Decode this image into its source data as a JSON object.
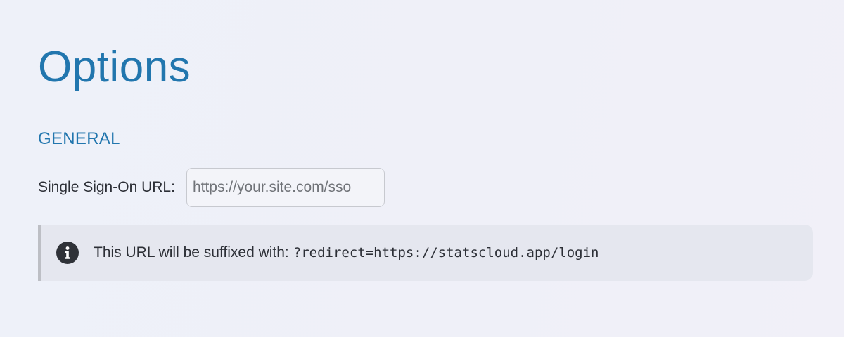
{
  "page": {
    "title": "Options"
  },
  "general_section": {
    "heading": "GENERAL",
    "sso_url": {
      "label": "Single Sign-On URL:",
      "value": "",
      "placeholder": "https://your.site.com/sso"
    }
  },
  "notice": {
    "icon": "info-icon",
    "text": "This URL will be suffixed with:",
    "code": "?redirect=https://statscloud.app/login"
  },
  "colors": {
    "accent": "#2176ae",
    "notice_background": "#e5e7ef",
    "notice_border": "#bdbfc5",
    "icon_fill": "#2f3238"
  }
}
